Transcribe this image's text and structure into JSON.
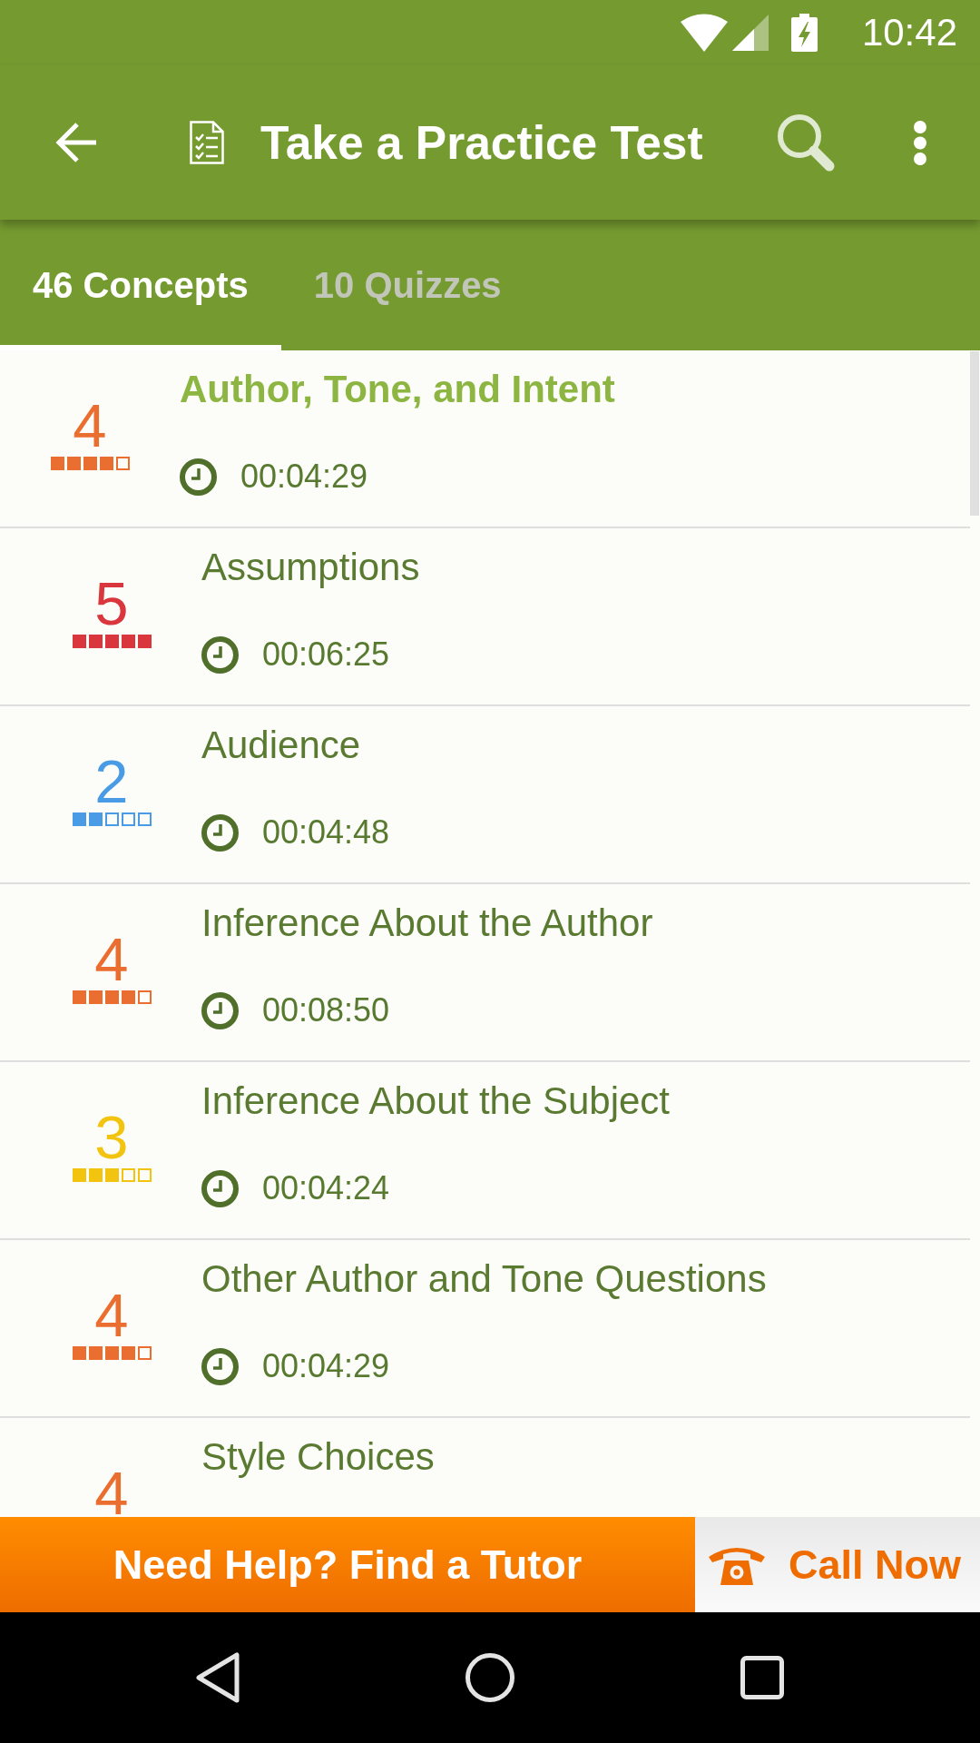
{
  "status_bar": {
    "time": "10:42"
  },
  "app_bar": {
    "title": "Take a Practice Test"
  },
  "tabs": [
    {
      "label": "46 Concepts",
      "selected": true
    },
    {
      "label": "10 Quizzes",
      "selected": false
    }
  ],
  "concepts": [
    {
      "title": "Author, Tone, and Intent",
      "difficulty": "4",
      "stars": 4,
      "color": "#ea6e2f",
      "time": "00:04:29",
      "selected": true
    },
    {
      "title": "Assumptions",
      "difficulty": "5",
      "stars": 5,
      "color": "#d9363d",
      "time": "00:06:25",
      "selected": false
    },
    {
      "title": "Audience",
      "difficulty": "2",
      "stars": 2,
      "color": "#4a9be6",
      "time": "00:04:48",
      "selected": false
    },
    {
      "title": "Inference About the Author",
      "difficulty": "4",
      "stars": 4,
      "color": "#ea6e2f",
      "time": "00:08:50",
      "selected": false
    },
    {
      "title": "Inference About the Subject",
      "difficulty": "3",
      "stars": 3,
      "color": "#f2c40f",
      "time": "00:04:24",
      "selected": false
    },
    {
      "title": "Other Author and Tone Questions",
      "difficulty": "4",
      "stars": 4,
      "color": "#ea6e2f",
      "time": "00:04:29",
      "selected": false
    },
    {
      "title": "Style Choices",
      "difficulty": "4",
      "color": "#ea6e2f",
      "selected": false
    }
  ],
  "help_banner": {
    "label": "Need Help? Find a Tutor"
  },
  "call_button": {
    "label": "Call Now"
  }
}
